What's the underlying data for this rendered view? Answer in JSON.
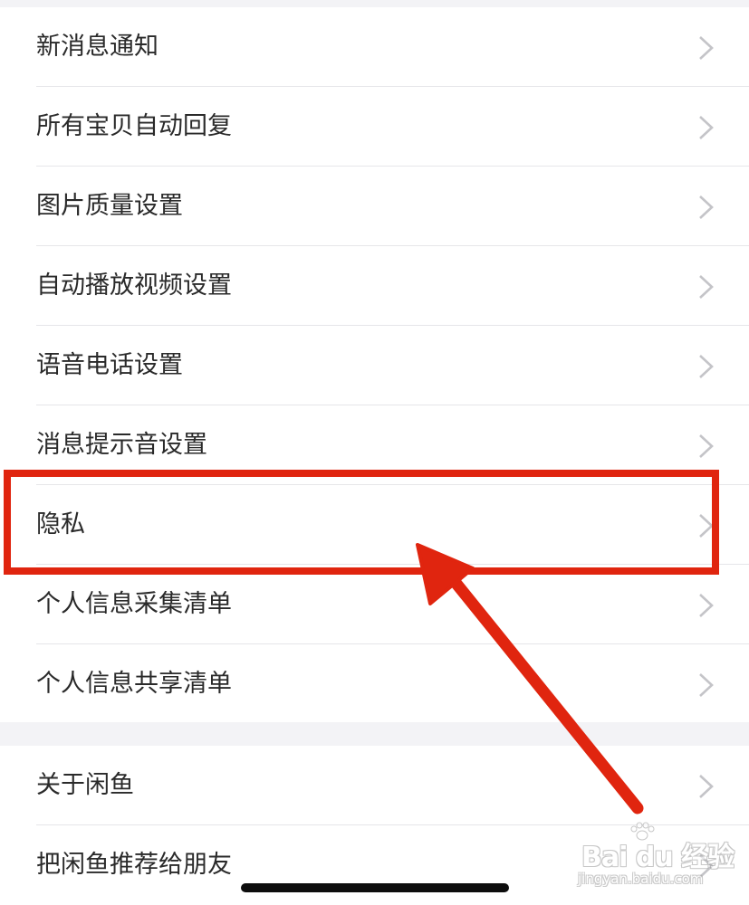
{
  "settings": {
    "group1": [
      {
        "label": "新消息通知"
      },
      {
        "label": "所有宝贝自动回复"
      },
      {
        "label": "图片质量设置"
      },
      {
        "label": "自动播放视频设置"
      },
      {
        "label": "语音电话设置"
      },
      {
        "label": "消息提示音设置"
      },
      {
        "label": "隐私"
      },
      {
        "label": "个人信息采集清单"
      },
      {
        "label": "个人信息共享清单"
      }
    ],
    "group2": [
      {
        "label": "关于闲鱼"
      },
      {
        "label": "把闲鱼推荐给朋友"
      }
    ]
  },
  "annotation": {
    "highlighted_item": "隐私",
    "color": "#e0250f"
  },
  "watermark": {
    "brand": "Bai du 经验",
    "url": "jingyan.baidu.com"
  },
  "icons": {
    "row_chevron": "chevron-right-icon",
    "watermark_logo": "paw-icon"
  }
}
